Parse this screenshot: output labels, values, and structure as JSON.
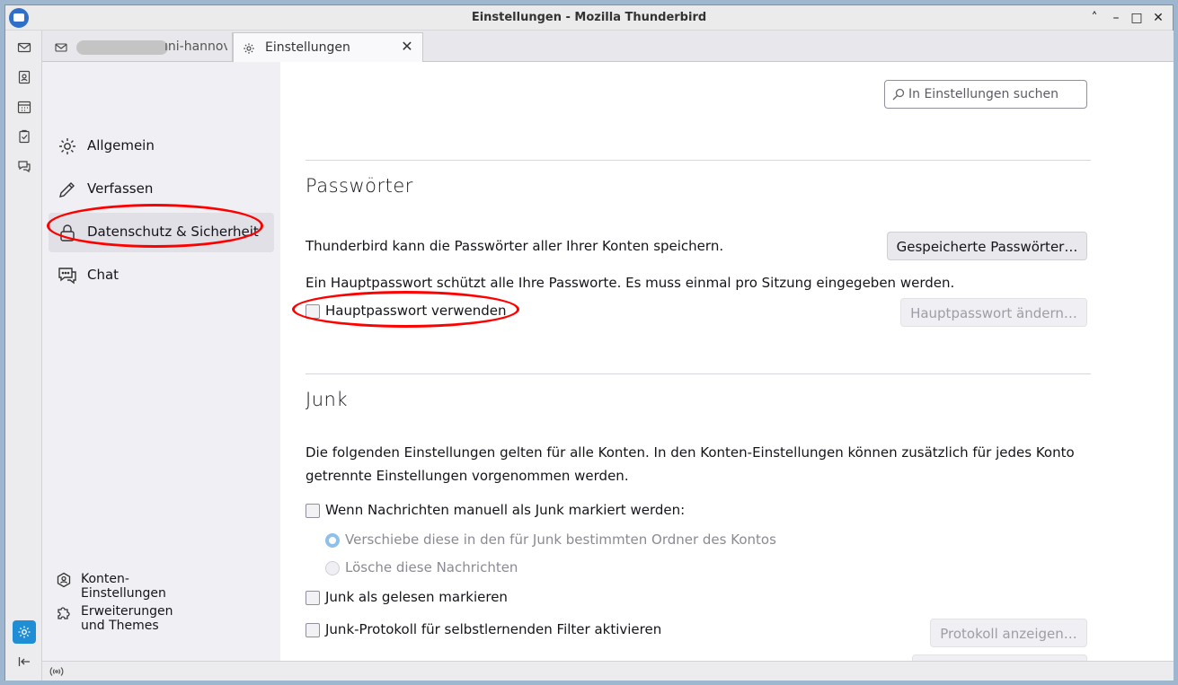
{
  "window": {
    "title": "Einstellungen - Mozilla Thunderbird",
    "controls": [
      "˄",
      "–",
      "□",
      "✕"
    ]
  },
  "tabs": [
    {
      "label": "ıni-hannov",
      "icon": "mail-icon"
    },
    {
      "label": "Einstellungen",
      "icon": "gear-icon",
      "close": "✕"
    }
  ],
  "sidebar": {
    "categories": [
      {
        "label": "Allgemein",
        "icon": "gear-icon"
      },
      {
        "label": "Verfassen",
        "icon": "pencil-icon"
      },
      {
        "label": "Datenschutz & Sicherheit",
        "icon": "lock-icon",
        "selected": true
      },
      {
        "label": "Chat",
        "icon": "chat-icon"
      }
    ],
    "footer": [
      {
        "label": "Konten-Einstellungen",
        "icon": "account-icon"
      },
      {
        "label": "Erweiterungen und Themes",
        "icon": "puzzle-icon"
      }
    ]
  },
  "search": {
    "placeholder": "In Einstellungen suchen"
  },
  "passwords": {
    "title": "Passwörter",
    "description": "Thunderbird kann die Passwörter aller Ihrer Konten speichern.",
    "saved_button": "Gespeicherte Passwörter…",
    "primary_description": "Ein Hauptpasswort schützt alle Ihre Passworte. Es muss einmal pro Sitzung eingegeben werden.",
    "use_primary_label": "Hauptpasswort verwenden",
    "use_primary_checked": false,
    "change_primary_button": "Hauptpasswort ändern…"
  },
  "junk": {
    "title": "Junk",
    "description": "Die folgenden Einstellungen gelten für alle Konten. In den Konten-Einstellungen können zusätzlich für jedes Konto getrennte Einstellungen vorgenommen werden.",
    "manual_mark_label": "Wenn Nachrichten manuell als Junk markiert werden:",
    "move_option": "Verschiebe diese in den für Junk bestimmten Ordner des Kontos",
    "delete_option": "Lösche diese Nachrichten",
    "mark_read_label": "Junk als gelesen markieren",
    "log_label": "Junk-Protokoll für selbstlernenden Filter aktivieren",
    "show_log_button": "Protokoll anzeigen…"
  },
  "colors": {
    "accent": "#1f8ed4",
    "annotation": "#ff0000"
  }
}
